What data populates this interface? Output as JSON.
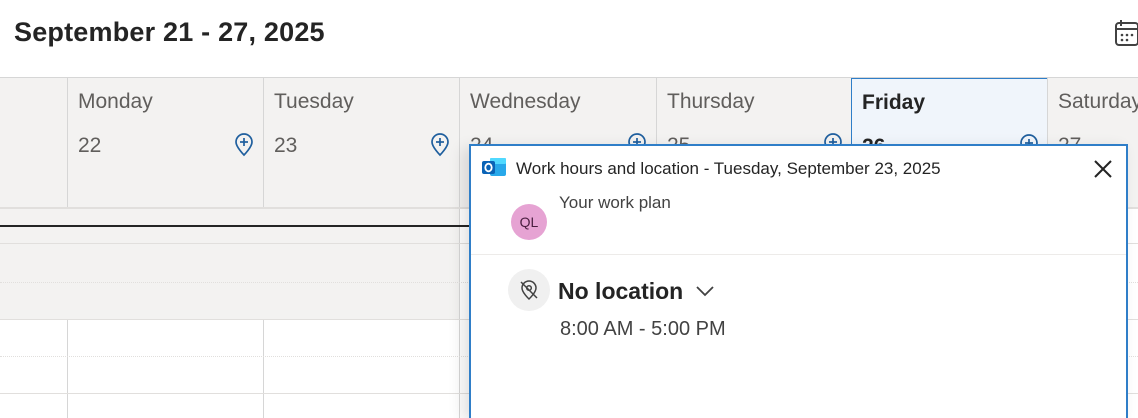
{
  "header": {
    "title": "September 21 - 27, 2025"
  },
  "days": [
    {
      "name": "Monday",
      "number": "22"
    },
    {
      "name": "Tuesday",
      "number": "23"
    },
    {
      "name": "Wednesday",
      "number": "24"
    },
    {
      "name": "Thursday",
      "number": "25"
    },
    {
      "name": "Friday",
      "number": "26"
    },
    {
      "name": "Saturday",
      "number": "27"
    }
  ],
  "popup": {
    "title": "Work hours and location - Tuesday, September 23, 2025",
    "avatar_initials": "QL",
    "plan_label": "Your work plan",
    "location": "No location",
    "time_range": "8:00 AM - 5:00 PM"
  },
  "colors": {
    "accent": "#2f7ec8",
    "avatar_bg": "#e6a3d3",
    "header_bg": "#f3f2f1"
  }
}
